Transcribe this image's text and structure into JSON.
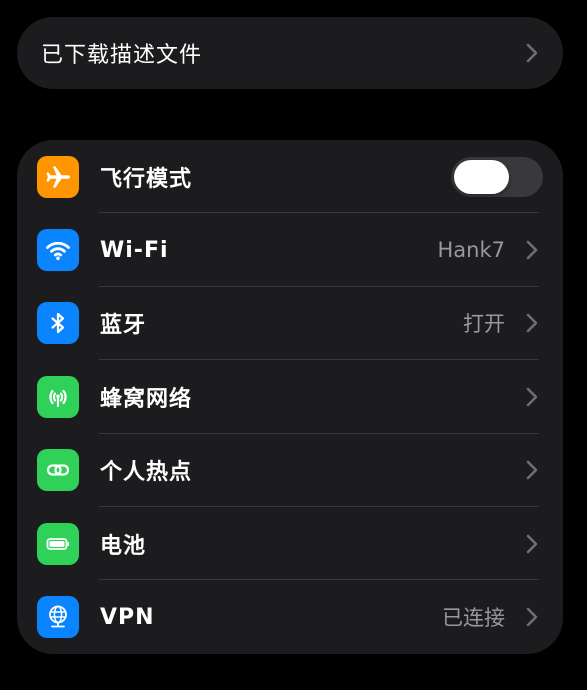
{
  "profiles": {
    "label": "已下载描述文件"
  },
  "settings": {
    "items": [
      {
        "key": "airplane",
        "label": "飞行模式",
        "value": "",
        "toggle_on": false,
        "icon": "airplane-icon",
        "icon_color": "#ff9500"
      },
      {
        "key": "wifi",
        "label": "Wi-Fi",
        "value": "Hank7",
        "icon": "wifi-icon",
        "icon_color": "#0a84ff"
      },
      {
        "key": "bluetooth",
        "label": "蓝牙",
        "value": "打开",
        "icon": "bluetooth-icon",
        "icon_color": "#0a84ff"
      },
      {
        "key": "cellular",
        "label": "蜂窝网络",
        "value": "",
        "icon": "cellular-antenna-icon",
        "icon_color": "#30d158"
      },
      {
        "key": "hotspot",
        "label": "个人热点",
        "value": "",
        "icon": "hotspot-link-icon",
        "icon_color": "#30d158"
      },
      {
        "key": "battery",
        "label": "电池",
        "value": "",
        "icon": "battery-icon",
        "icon_color": "#30d158"
      },
      {
        "key": "vpn",
        "label": "VPN",
        "value": "已连接",
        "icon": "vpn-globe-icon",
        "icon_color": "#0a84ff"
      }
    ]
  },
  "colors": {
    "background": "#000000",
    "group_background": "#1c1c1e",
    "separator": "#38383a",
    "secondary_text": "#98989d",
    "toggle_off": "#39393d"
  }
}
